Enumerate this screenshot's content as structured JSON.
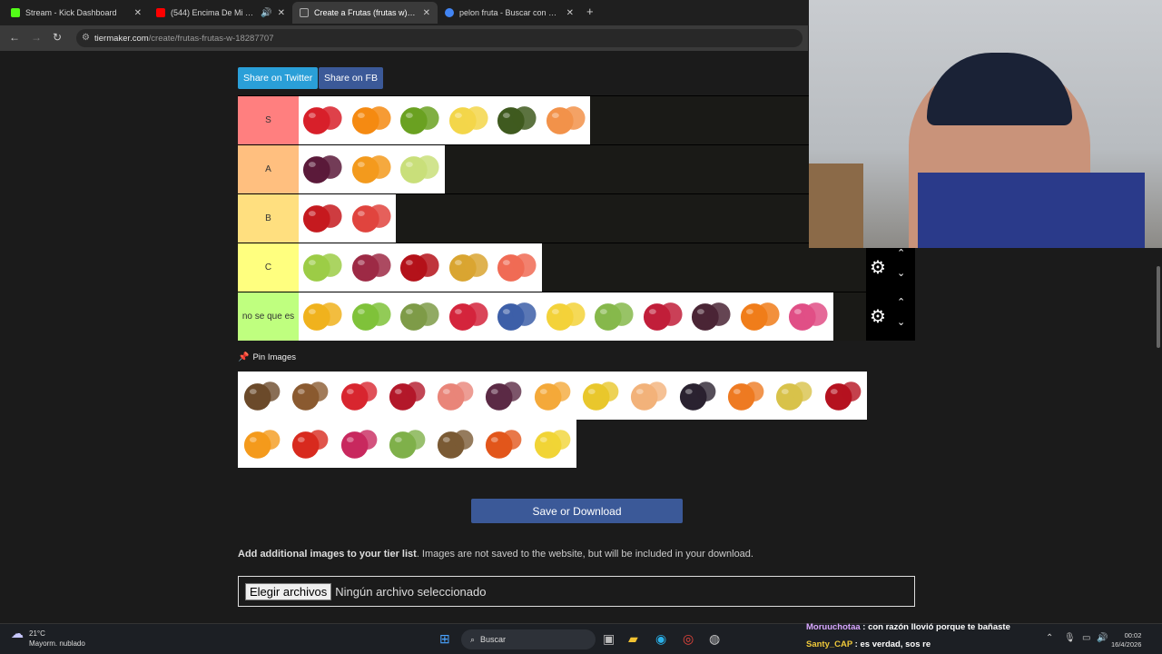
{
  "tabs": [
    {
      "title": "Stream - Kick Dashboard",
      "color": "#53fc18"
    },
    {
      "title": "(544) Encima De Mi (Latin T...",
      "color": "#ff0000"
    },
    {
      "title": "Create a Frutas (frutas w) Tier Li...",
      "color": "#222222"
    },
    {
      "title": "pelon fruta - Buscar con Googl...",
      "color": "#4285f4"
    }
  ],
  "address": {
    "domain": "tiermaker.com",
    "path": "/create/frutas-frutas-w-18287707"
  },
  "share": {
    "twitter": "Share on Twitter",
    "facebook": "Share on FB"
  },
  "tiers": [
    {
      "label": "S",
      "color": "#ff7f7f",
      "items": [
        {
          "fruit": "strawberry",
          "color": "#d8202a"
        },
        {
          "fruit": "orange",
          "color": "#f58a12"
        },
        {
          "fruit": "kiwi",
          "color": "#6aa121"
        },
        {
          "fruit": "banana",
          "color": "#f3d64a"
        },
        {
          "fruit": "avocado",
          "color": "#3f5a1f"
        },
        {
          "fruit": "peach",
          "color": "#f2924a"
        }
      ]
    },
    {
      "label": "A",
      "color": "#ffbf7f",
      "items": [
        {
          "fruit": "plum",
          "color": "#5b1a3a"
        },
        {
          "fruit": "mandarin",
          "color": "#f39a1d"
        },
        {
          "fruit": "pear",
          "color": "#c9df7a"
        }
      ]
    },
    {
      "label": "B",
      "color": "#ffdf7f",
      "items": [
        {
          "fruit": "apple",
          "color": "#c51a1f"
        },
        {
          "fruit": "watermelon",
          "color": "#e0443e"
        }
      ]
    },
    {
      "label": "C",
      "color": "#ffff7f",
      "items": [
        {
          "fruit": "green-grapes",
          "color": "#9ccc46"
        },
        {
          "fruit": "red-grapes",
          "color": "#9d2a45"
        },
        {
          "fruit": "cherry",
          "color": "#b4121a"
        },
        {
          "fruit": "pineapple",
          "color": "#d9a531"
        },
        {
          "fruit": "grapefruit",
          "color": "#f06b55"
        }
      ]
    },
    {
      "label": "no se que es",
      "color": "#bfff7f",
      "items": [
        {
          "fruit": "mango",
          "color": "#f0b21d"
        },
        {
          "fruit": "lime",
          "color": "#7fc23a"
        },
        {
          "fruit": "soursop",
          "color": "#7e9b48"
        },
        {
          "fruit": "rambutan",
          "color": "#d4253c"
        },
        {
          "fruit": "blueberry",
          "color": "#3d5fa8"
        },
        {
          "fruit": "starfruit",
          "color": "#f3d23a"
        },
        {
          "fruit": "green-fruit",
          "color": "#86b84b"
        },
        {
          "fruit": "raspberry",
          "color": "#c11e3a"
        },
        {
          "fruit": "mangosteen",
          "color": "#4a2535"
        },
        {
          "fruit": "papaya",
          "color": "#f07d1a"
        },
        {
          "fruit": "dragonfruit",
          "color": "#e04f86"
        }
      ]
    }
  ],
  "tier_controls": {
    "gear_icon": "⚙",
    "up_icon": "⌃",
    "down_icon": "⌄"
  },
  "pin_images": {
    "title": "Pin Images"
  },
  "pool": [
    {
      "fruit": "tamarind-mix",
      "color": "#6b4a2a"
    },
    {
      "fruit": "sapote",
      "color": "#8a5a30"
    },
    {
      "fruit": "strawberries",
      "color": "#d8262f"
    },
    {
      "fruit": "pomegranate",
      "color": "#b3182a"
    },
    {
      "fruit": "guava",
      "color": "#e98579"
    },
    {
      "fruit": "fig",
      "color": "#5b2a45"
    },
    {
      "fruit": "mango",
      "color": "#f4a93a"
    },
    {
      "fruit": "passion-fruit",
      "color": "#e9c72c"
    },
    {
      "fruit": "melon",
      "color": "#f2b27a"
    },
    {
      "fruit": "blackberry",
      "color": "#2a2230"
    },
    {
      "fruit": "papaya",
      "color": "#ee7a22"
    },
    {
      "fruit": "quince",
      "color": "#d8c24a"
    },
    {
      "fruit": "chili",
      "color": "#b5121f"
    },
    {
      "fruit": "orange",
      "color": "#f49a1c"
    },
    {
      "fruit": "tomato",
      "color": "#d82a1e"
    },
    {
      "fruit": "pitaya",
      "color": "#c8285e"
    },
    {
      "fruit": "prickly-pear",
      "color": "#7fb04a"
    },
    {
      "fruit": "kiwi",
      "color": "#7a5a34"
    },
    {
      "fruit": "papaya-slice",
      "color": "#e2561b"
    },
    {
      "fruit": "lemon",
      "color": "#f1d436"
    }
  ],
  "save_button": "Save or Download",
  "add_images": {
    "bold": "Add additional images to your tier list",
    "rest": ". Images are not saved to the website, but will be included in your download."
  },
  "file_input": {
    "button": "Elegir archivos",
    "status": "Ningún archivo seleccionado"
  },
  "taskbar": {
    "weather_temp": "21°C",
    "weather_desc": "Mayorm. nublado",
    "search": "Buscar",
    "time": "00:02",
    "date": "16/4/2026"
  },
  "chat": [
    {
      "user": "Moruuchotaa",
      "message": " : con razón llovió porque te bañaste"
    },
    {
      "user": "Santy_CAP",
      "message": " : es verdad, sos re"
    }
  ]
}
